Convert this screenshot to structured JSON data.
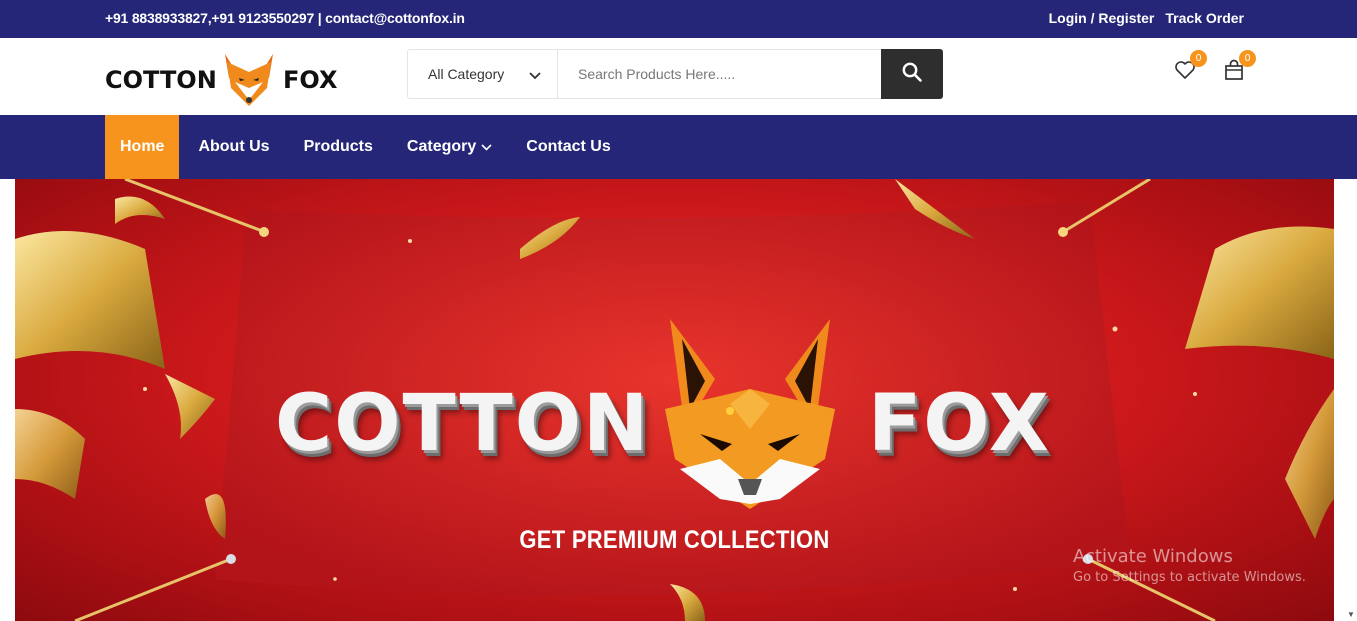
{
  "topbar": {
    "contact": "+91 8838933827,+91 9123550297 | contact@cottonfox.in",
    "login": "Login / Register",
    "track": "Track Order"
  },
  "header": {
    "logo_alt": "COTTON FOX",
    "logo_left": "COTTON",
    "logo_right": "FOX",
    "category": "All Category",
    "search_placeholder": "Search Products Here.....",
    "wishlist_count": "0",
    "cart_count": "0"
  },
  "nav": {
    "home": "Home",
    "about": "About Us",
    "products": "Products",
    "category": "Category",
    "contact": "Contact Us"
  },
  "banner": {
    "brand_left": "COTTON",
    "brand_right": "FOX",
    "tagline": "GET PREMIUM COLLECTION"
  },
  "watermark": {
    "line1": "Activate Windows",
    "line2": "Go to Settings to activate Windows."
  },
  "colors": {
    "nav_bg": "#252678",
    "accent": "#f7941d",
    "banner_red": "#d11a1c"
  }
}
